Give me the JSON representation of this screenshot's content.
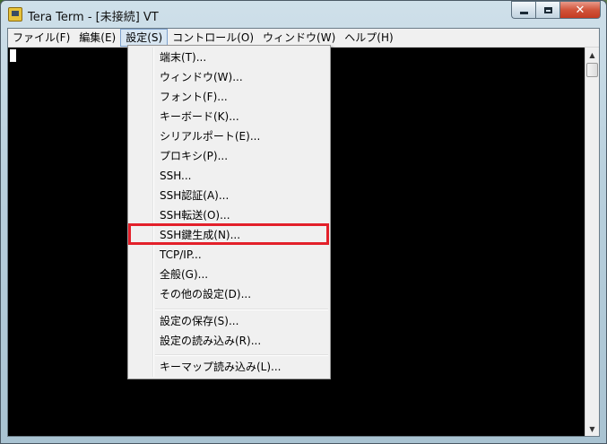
{
  "window": {
    "title": "Tera Term - [未接続] VT",
    "close_glyph": "✕"
  },
  "menubar": {
    "items": [
      {
        "label": "ファイル(F)"
      },
      {
        "label": "編集(E)"
      },
      {
        "label": "設定(S)"
      },
      {
        "label": "コントロール(O)"
      },
      {
        "label": "ウィンドウ(W)"
      },
      {
        "label": "ヘルプ(H)"
      }
    ],
    "active_item": "設定(S)"
  },
  "settings_menu": {
    "items": [
      {
        "label": "端末(T)..."
      },
      {
        "label": "ウィンドウ(W)..."
      },
      {
        "label": "フォント(F)..."
      },
      {
        "label": "キーボード(K)..."
      },
      {
        "label": "シリアルポート(E)..."
      },
      {
        "label": "プロキシ(P)..."
      },
      {
        "label": "SSH..."
      },
      {
        "label": "SSH認証(A)..."
      },
      {
        "label": "SSH転送(O)..."
      },
      {
        "label": "SSH鍵生成(N)..."
      },
      {
        "label": "TCP/IP..."
      },
      {
        "label": "全般(G)..."
      },
      {
        "label": "その他の設定(D)..."
      },
      {
        "label": "設定の保存(S)..."
      },
      {
        "label": "設定の読み込み(R)..."
      },
      {
        "label": "キーマップ読み込み(L)..."
      }
    ],
    "highlighted_item": "SSH鍵生成(N)...",
    "highlight_color": "#e3202a"
  },
  "scrollbar": {
    "up_glyph": "▲",
    "down_glyph": "▼"
  },
  "colors": {
    "terminal_background": "#000000",
    "cursor": "#ffffff"
  }
}
